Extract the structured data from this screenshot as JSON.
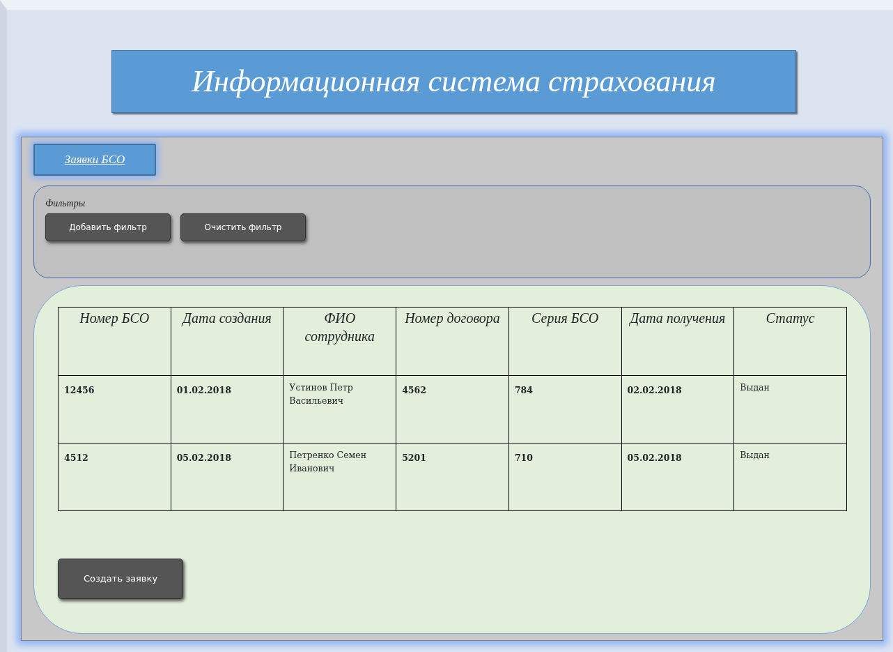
{
  "header": {
    "title": "Информационная система страхования"
  },
  "tabs": [
    {
      "label": "Заявки БСО",
      "selected": true
    }
  ],
  "filters": {
    "title": "Фильтры",
    "buttons": [
      "Добавить фильтр",
      "Очистить фильтр"
    ]
  },
  "table": {
    "columns": [
      "Номер БСО",
      "Дата создания",
      "ФИО сотрудника",
      "Номер договора",
      "Серия БСО",
      "Дата получения",
      "Статус"
    ],
    "rows": [
      [
        "12456",
        "01.02.2018",
        "Устинов Петр Васильевич",
        "4562",
        "784",
        "02.02.2018",
        "Выдан"
      ],
      [
        "4512",
        "05.02.2018",
        "Петренко Семен Иванович",
        "5201",
        "710",
        "05.02.2018",
        "Выдан"
      ]
    ]
  },
  "create_button": "Создать заявку"
}
